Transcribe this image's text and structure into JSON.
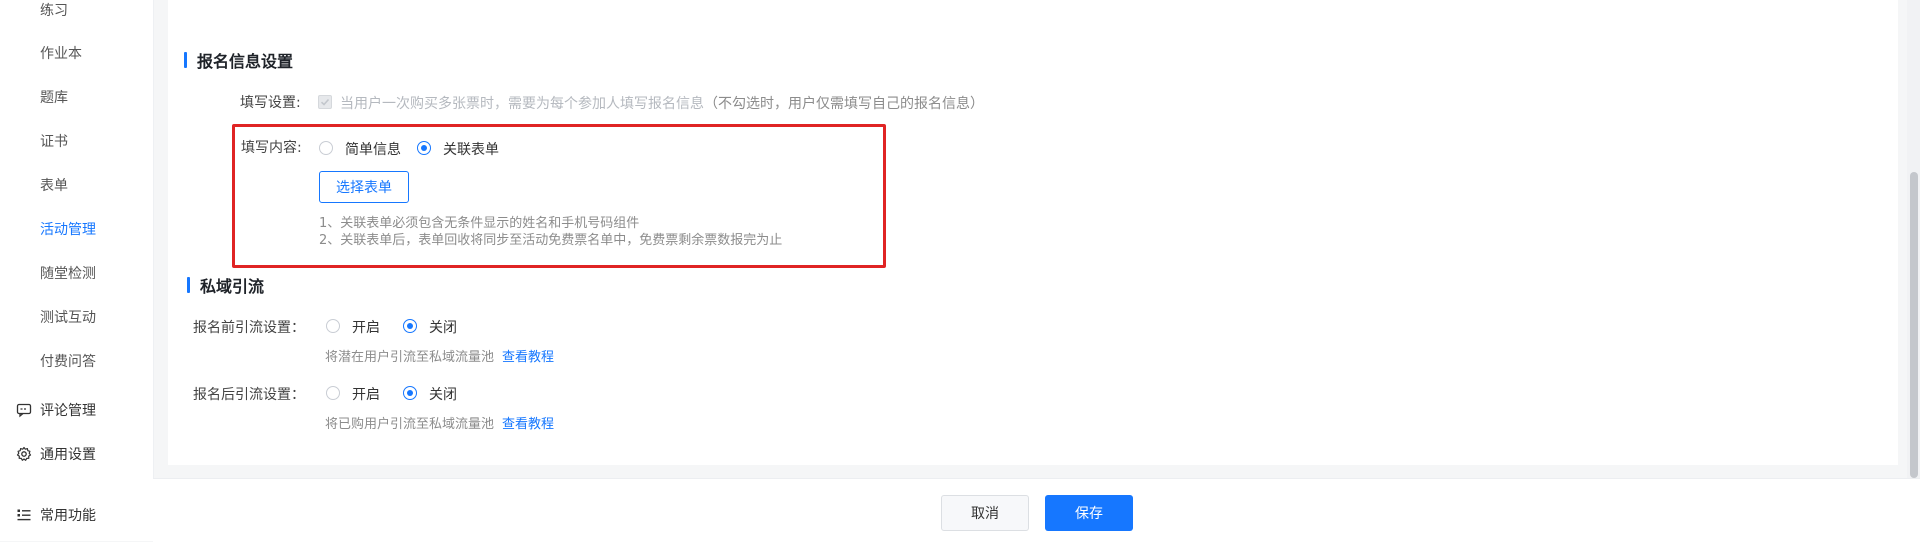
{
  "sidebar": {
    "items": [
      {
        "label": "练习"
      },
      {
        "label": "作业本"
      },
      {
        "label": "题库"
      },
      {
        "label": "证书"
      },
      {
        "label": "表单"
      },
      {
        "label": "活动管理",
        "active": true
      },
      {
        "label": "随堂检测"
      },
      {
        "label": "测试互动"
      },
      {
        "label": "付费问答"
      }
    ],
    "groups": [
      {
        "label": "评论管理",
        "icon": "comment-icon"
      },
      {
        "label": "通用设置",
        "icon": "gear-icon"
      },
      {
        "label": "常用功能",
        "icon": "list-icon"
      }
    ]
  },
  "signup": {
    "title": "报名信息设置",
    "fill_setting_label": "填写设置:",
    "fill_setting_text": "当用户一次购买多张票时，需要为每个参加人填写报名信息",
    "fill_setting_hint": "（不勾选时，用户仅需填写自己的报名信息）",
    "fill_content_label": "填写内容:",
    "option_simple": "简单信息",
    "option_form": "关联表单",
    "select_form_button": "选择表单",
    "note_1": "1、关联表单必须包含无条件显示的姓名和手机号码组件",
    "note_2": "2、关联表单后，表单回收将同步至活动免费票名单中，免费票剩余票数报完为止"
  },
  "private": {
    "title": "私域引流",
    "before_label": "报名前引流设置：",
    "before_on": "开启",
    "before_off": "关闭",
    "before_hint": "将潜在用户引流至私域流量池",
    "before_link": "查看教程",
    "after_label": "报名后引流设置：",
    "after_on": "开启",
    "after_off": "关闭",
    "after_hint": "将已购用户引流至私域流量池",
    "after_link": "查看教程"
  },
  "footer": {
    "cancel": "取消",
    "save": "保存"
  },
  "colors": {
    "accent": "#1677ff",
    "highlight": "#e02424"
  }
}
